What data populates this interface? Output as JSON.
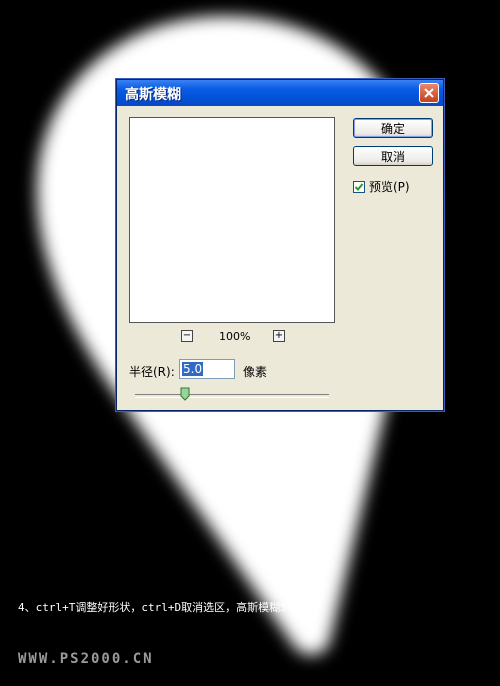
{
  "dialog": {
    "title": "高斯模糊",
    "ok_label": "确定",
    "cancel_label": "取消",
    "preview_label": "预览(P)",
    "preview_checked": true,
    "zoom_out_symbol": "−",
    "zoom_in_symbol": "+",
    "zoom_level": "100%",
    "radius_label": "半径(R):",
    "radius_value": "5.0",
    "radius_unit": "像素",
    "radius_slider_fraction": 0.26
  },
  "caption": "4、ctrl+T调整好形状，ctrl+D取消选区，高斯模糊5像素",
  "watermark": "WWW.PS2000.CN",
  "colors": {
    "titlebar": "#0052D8",
    "dialog_bg": "#ECE9D8",
    "shape_fill": "#FFFFFF",
    "background": "#000000"
  }
}
